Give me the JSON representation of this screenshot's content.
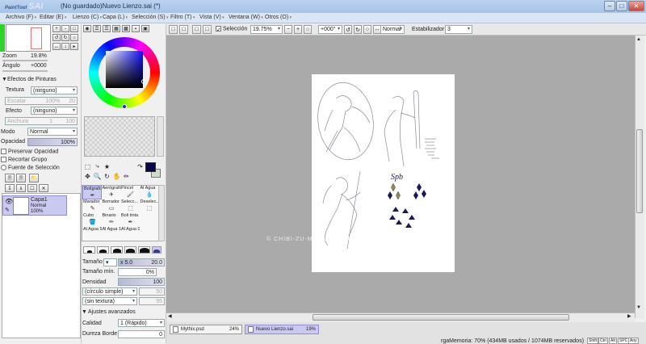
{
  "app": {
    "logo_small": "PaintTool",
    "logo_big": "SAI",
    "window_title": "(No guardado)Nuevo Lienzo.sai (*)"
  },
  "menu": [
    "Archivo (F)",
    "Editar (E)",
    "Lienzo (C)",
    "Capa (L)",
    "Selección (S)",
    "Filtro (T)",
    "Vista (V)",
    "Ventana (W)",
    "Otros (O)"
  ],
  "navigator": {
    "zoom_label": "Zoom",
    "zoom_value": "19.8%",
    "angle_label": "Ángulo",
    "angle_value": "+0000"
  },
  "effects": {
    "header": "Efectos de Pinturas",
    "texture_label": "Textura",
    "texture_value": "(ninguno)",
    "texture_sub_label": "Escalar",
    "texture_sub_value": "100%",
    "texture_sub_num": "20",
    "effect_label": "Efecto",
    "effect_value": "(ninguno)",
    "effect_sub_label": "Anchura",
    "effect_sub_num": "1",
    "effect_sub_num2": "100"
  },
  "layer_props": {
    "mode_label": "Modo",
    "mode_value": "Normal",
    "opacity_label": "Opacidad",
    "opacity_value": "100%",
    "preserve_opacity": "Preservar Opacidad",
    "clip_group": "Recortar Grupo",
    "selection_source": "Fuente de Selección"
  },
  "layers": [
    {
      "name": "Capa1",
      "mode": "Normal",
      "opacity": "100%"
    }
  ],
  "toolbar": {
    "selection_label": "Selección",
    "zoom_value": "19.75%",
    "angle_value": "+000°",
    "blend_value": "Normal",
    "stabilizer_label": "Estabilizador",
    "stabilizer_value": "3"
  },
  "brush_tools": [
    {
      "label": "Bolígrafo",
      "icon": "✒"
    },
    {
      "label": "Aerógrafo",
      "icon": "✈"
    },
    {
      "label": "Pincel",
      "icon": "🖌"
    },
    {
      "label": "Al Agua",
      "icon": "💧"
    },
    {
      "label": "Marador",
      "icon": "✎"
    },
    {
      "label": "Borrador",
      "icon": "▭"
    },
    {
      "label": "Selecc...",
      "icon": "⬚"
    },
    {
      "label": "Deselec...",
      "icon": "⬚"
    },
    {
      "label": "Cubo",
      "icon": "🪣"
    },
    {
      "label": "Binario",
      "icon": "✏"
    },
    {
      "label": "Boli tinta",
      "icon": "✒"
    },
    {
      "label": "",
      "icon": ""
    },
    {
      "label": "Al Agua 9",
      "icon": ""
    },
    {
      "label": "Al Agua 10",
      "icon": ""
    },
    {
      "label": "Al Agua 01",
      "icon": ""
    },
    {
      "label": "",
      "icon": ""
    }
  ],
  "brush_settings": {
    "size_label": "Tamaño",
    "size_mult": "x 5.0",
    "size_value": "20.0",
    "min_size_label": "Tamaño mín.",
    "min_size_value": "0%",
    "density_label": "Densidad",
    "density_value": "100",
    "shape_value": "(círculo simple)",
    "shape_num": "50",
    "texture_value": "(sin textura)",
    "texture_num": "95",
    "advanced_header": "Ajustes avanzados",
    "quality_label": "Calidad",
    "quality_value": "1 (Rápido)",
    "hardness_label": "Dureza Borde",
    "hardness_value": "0"
  },
  "doc_tabs": [
    {
      "name": "Mythix.psd",
      "zoom": "24%"
    },
    {
      "name": "Nuevo Lienzo.sai",
      "zoom": "19%"
    }
  ],
  "status": {
    "memory": "rgaMemoria: 70% (434MB usados / 1074MB reservados)",
    "keys": [
      "Shift",
      "Ctrl",
      "Alt",
      "SPC",
      "Any"
    ]
  },
  "watermark": "© CHIBI-ZU-MANNY-DEVIANTART",
  "colors": {
    "primary": "#07074a",
    "secondary": "#cfdcc9",
    "selection": "#c9c9f2"
  }
}
